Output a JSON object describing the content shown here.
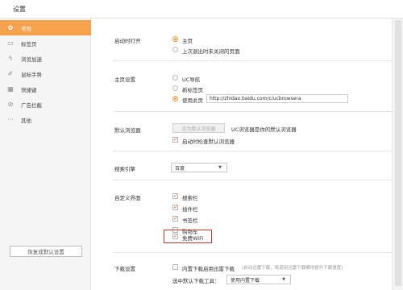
{
  "window": {
    "title": "设置"
  },
  "sidebar": {
    "items": [
      {
        "label": "常规",
        "icon": "gear-icon",
        "glyph": "✿",
        "active": true
      },
      {
        "label": "标签页",
        "icon": "tab-icon",
        "glyph": "▭",
        "active": false
      },
      {
        "label": "浏览加速",
        "icon": "lightning-icon",
        "glyph": "ϟ",
        "active": false
      },
      {
        "label": "鼠标手势",
        "icon": "gesture-icon",
        "glyph": "✐",
        "active": false
      },
      {
        "label": "快捷键",
        "icon": "keyboard-icon",
        "glyph": "▦",
        "active": false
      },
      {
        "label": "广告拦截",
        "icon": "block-icon",
        "glyph": "⊘",
        "active": false
      },
      {
        "label": "其他",
        "icon": "more-icon",
        "glyph": "···",
        "active": false
      }
    ],
    "restore_button": "恢复成默认设置"
  },
  "startup": {
    "label": "启动时打开",
    "options": [
      {
        "label": "主页",
        "selected": true
      },
      {
        "label": "上次退出时未关闭的页面",
        "selected": false
      }
    ]
  },
  "homepage": {
    "label": "主页设置",
    "options": [
      {
        "label": "UC导航",
        "selected": false
      },
      {
        "label": "新标签页",
        "selected": false
      },
      {
        "label": "使用此页",
        "selected": true
      }
    ],
    "url": "http://zhidao.baidu.com/c/ucbrowsera"
  },
  "default_browser": {
    "label": "默认浏览器",
    "button": "设为默认浏览器",
    "status": "UC浏览器是你的默认浏览器",
    "check_label": "启动时检查默认浏览器",
    "checked": true
  },
  "search": {
    "label": "搜索引擎",
    "selected": "百度"
  },
  "custom_ui": {
    "label": "自定义界面",
    "items": [
      {
        "label": "搜索栏",
        "checked": true
      },
      {
        "label": "插件栏",
        "checked": true
      },
      {
        "label": "书签栏",
        "checked": true
      },
      {
        "label": "购物车",
        "checked": false
      },
      {
        "label": "免费WiFi",
        "checked": true
      }
    ]
  },
  "download": {
    "label": "下载设置",
    "check_label": "内置下载启用迅雷下载",
    "hint": "(启动迅雷下载，将调用迅雷下载模块提升下载速度)",
    "checked": false,
    "default_tool_label": "选中默认下载工具：",
    "default_tool": "使用内置下载"
  },
  "colors": {
    "accent": "#f6a14b",
    "highlight": "#e0322b"
  }
}
